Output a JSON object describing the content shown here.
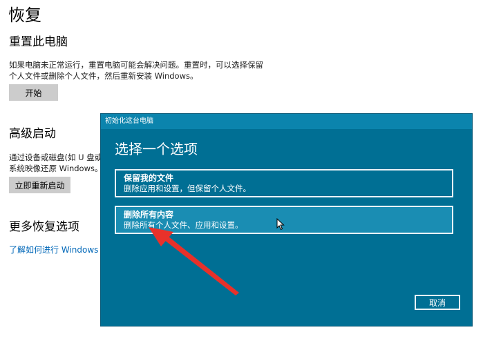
{
  "page": {
    "title": "恢复",
    "reset": {
      "heading": "重置此电脑",
      "desc_line1": "如果电脑未正常运行，重置电脑可能会解决问题。重置时，可以选择保留",
      "desc_line2": "个人文件或删除个人文件，然后重新安装 Windows。",
      "button": "开始"
    },
    "advanced": {
      "heading": "高级启动",
      "desc_line1": "通过设备或磁盘(如 U 盘或 D",
      "desc_line2": "系统映像还原 Windows。 这",
      "button": "立即重新启动"
    },
    "more": {
      "heading": "更多恢复选项",
      "link": "了解如何进行 Windows 的全"
    }
  },
  "dialog": {
    "title": "初始化这台电脑",
    "heading": "选择一个选项",
    "options": [
      {
        "title": "保留我的文件",
        "desc": "删除应用和设置，但保留个人文件。"
      },
      {
        "title": "删除所有内容",
        "desc": "删除所有个人文件、应用和设置。"
      }
    ],
    "cancel": "取消"
  },
  "colors": {
    "dialog_bg": "#006f94",
    "titlebar": "#0b84ad",
    "selected_option": "#1a8db3",
    "arrow": "#e8312a",
    "link": "#0067b8"
  }
}
